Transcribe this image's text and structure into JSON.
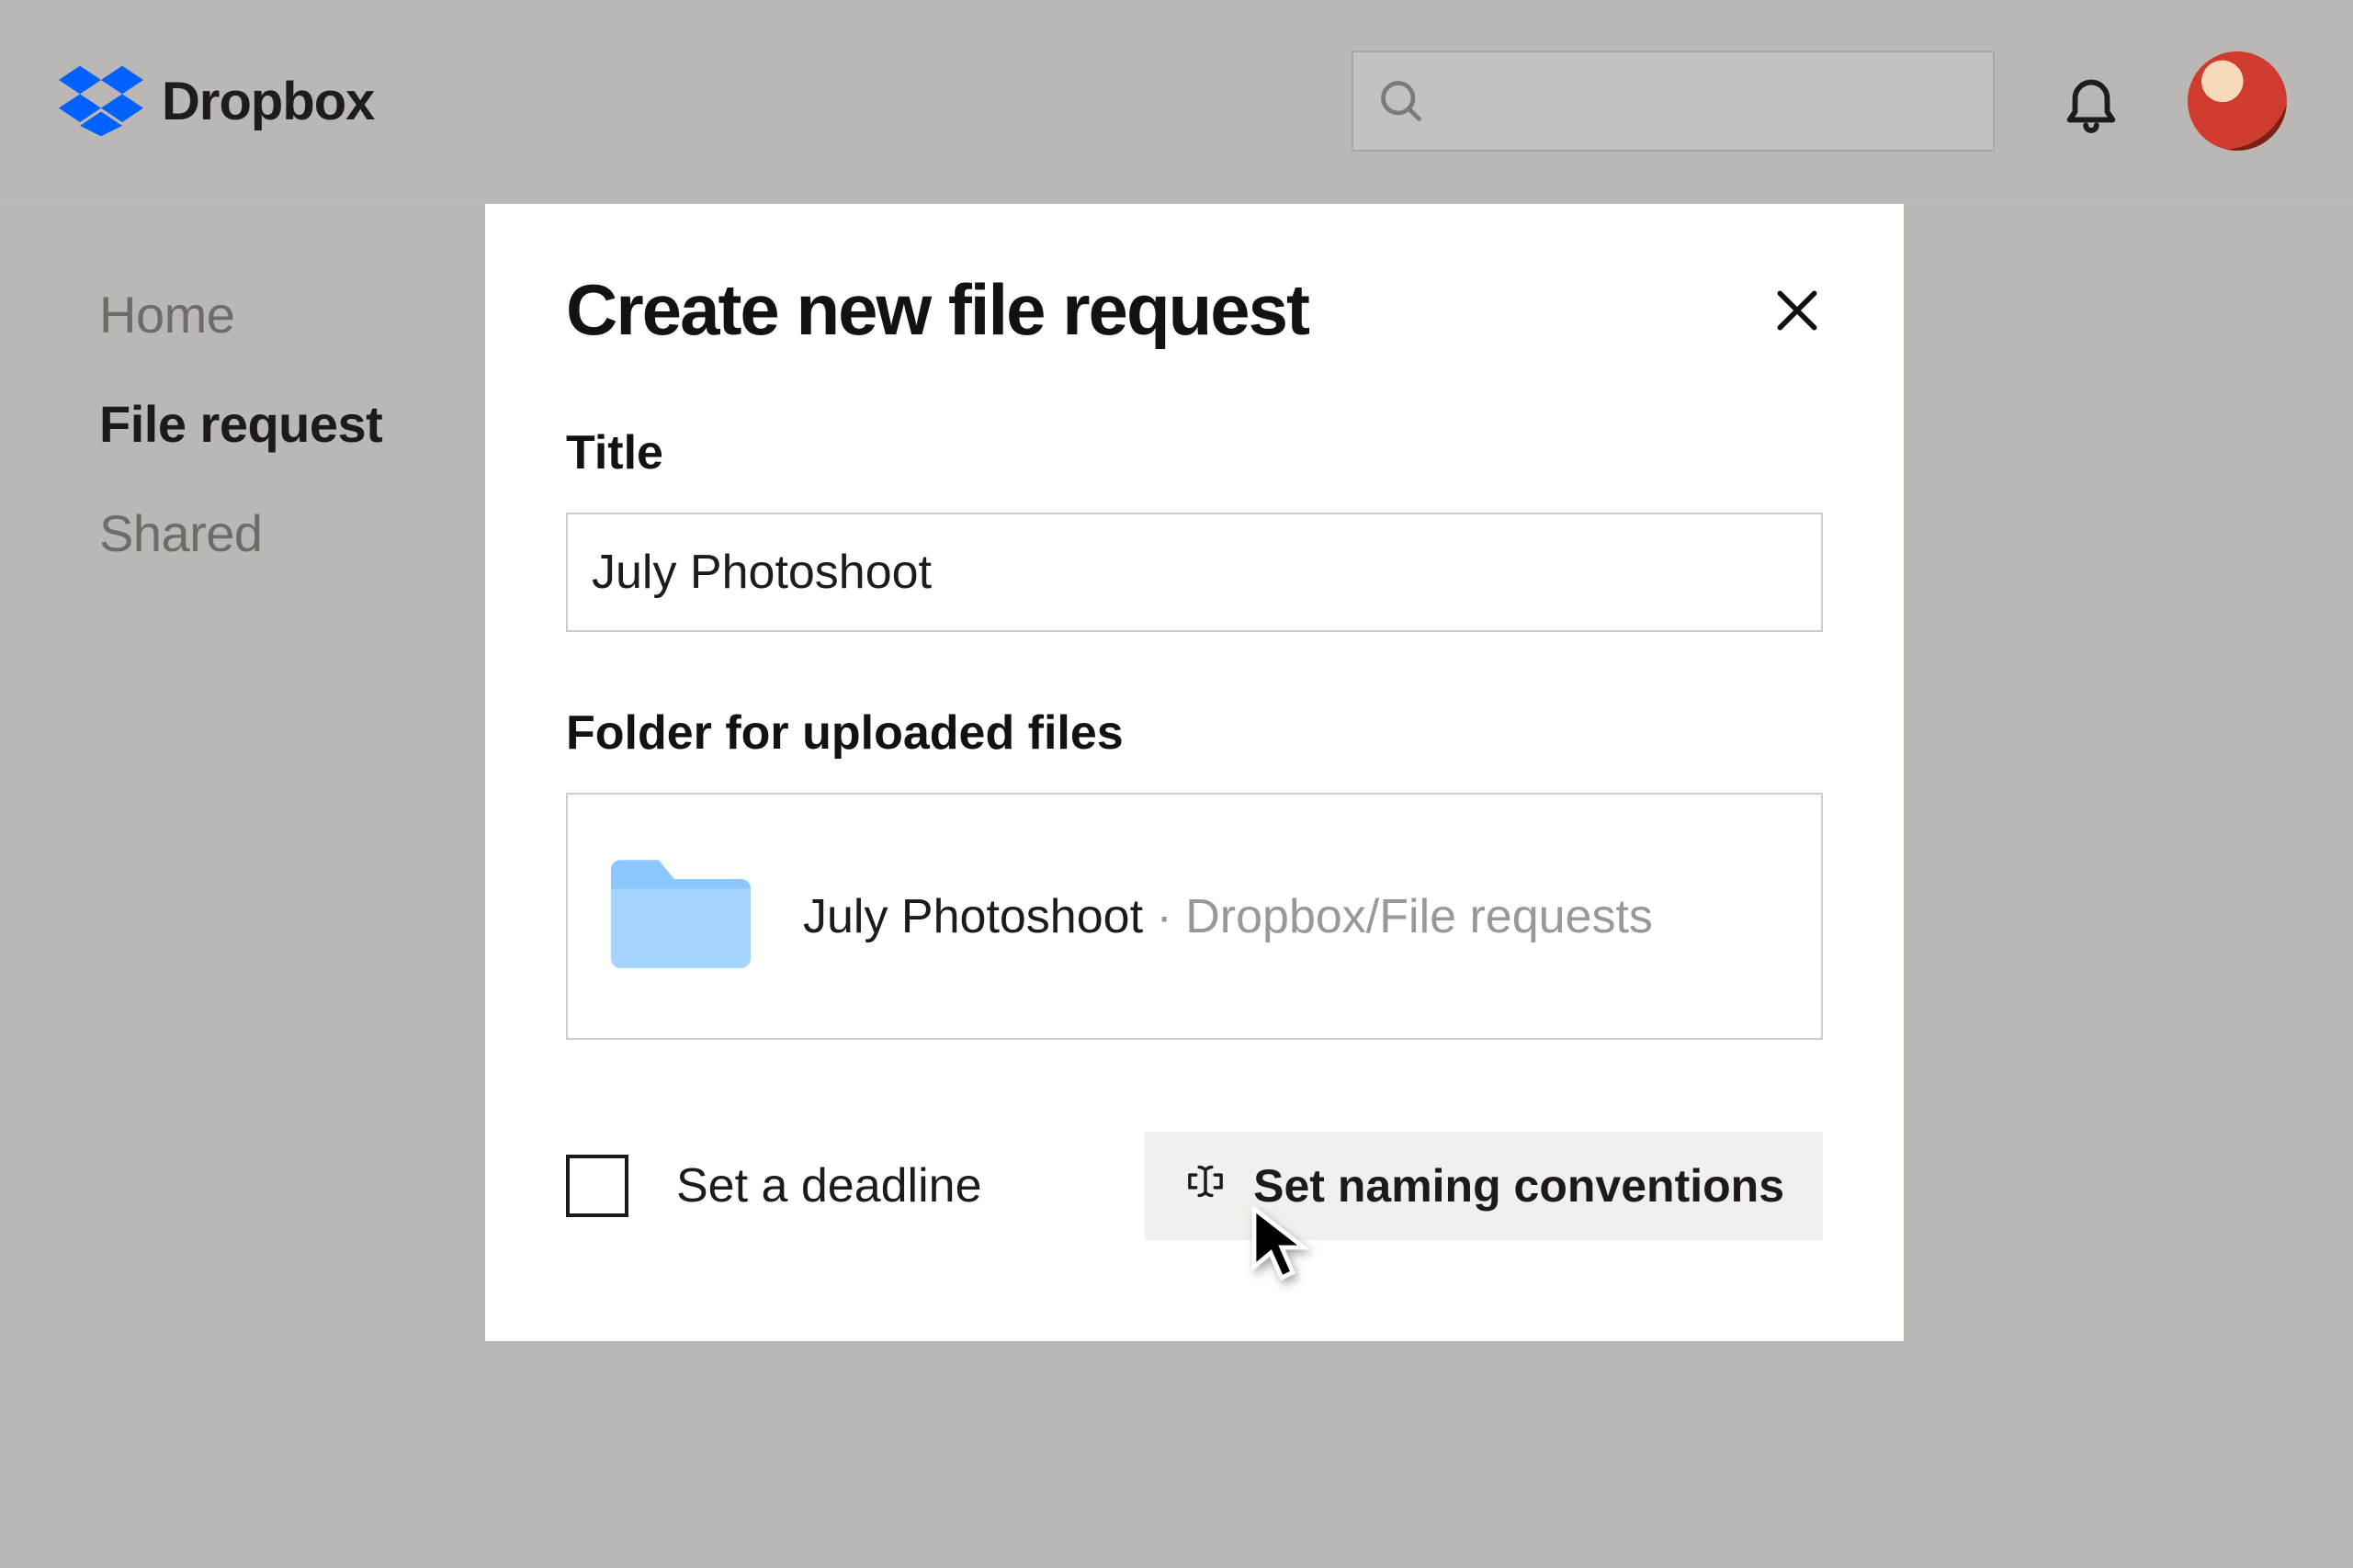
{
  "brand": {
    "name": "Dropbox"
  },
  "header": {
    "search_placeholder": ""
  },
  "sidebar": {
    "items": [
      {
        "label": "Home",
        "active": false
      },
      {
        "label": "File request",
        "active": true
      },
      {
        "label": "Shared",
        "active": false
      }
    ]
  },
  "modal": {
    "title": "Create new file request",
    "field_title_label": "Title",
    "title_value": "July Photoshoot",
    "folder_section_label": "Folder for uploaded files",
    "folder": {
      "name": "July Photoshoot",
      "separator": " · ",
      "path": "Dropbox/File requests"
    },
    "deadline_label": "Set a deadline",
    "deadline_checked": false,
    "naming_button_label": "Set naming conventions"
  }
}
